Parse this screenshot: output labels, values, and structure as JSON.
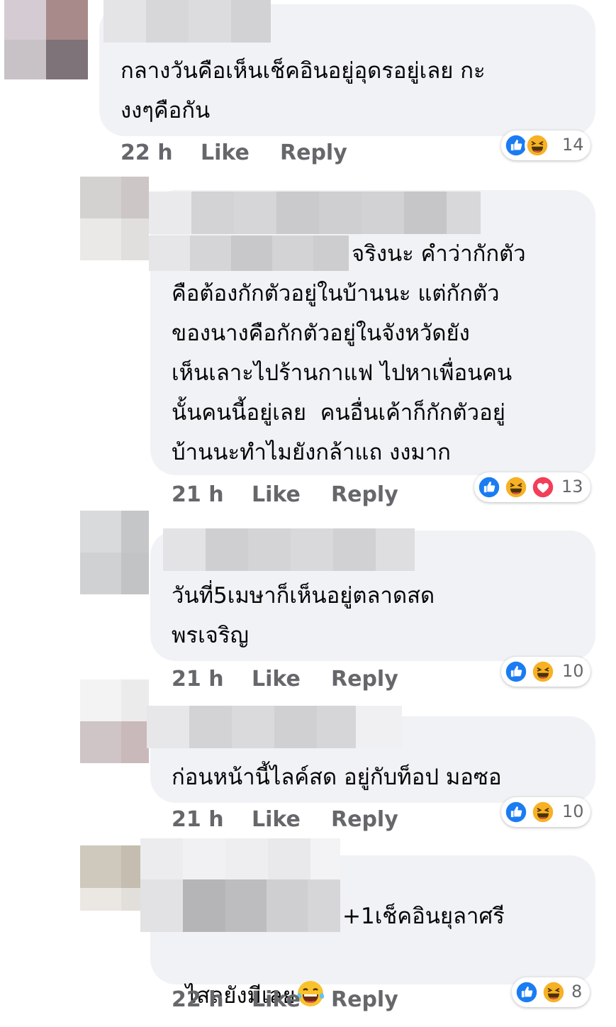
{
  "comments": [
    {
      "text": "กลางวันคือเห็นเช็คอินอยู่อุดรอยู่เลย กะ\nงงๆคือกัน",
      "time": "22 h",
      "like": "Like",
      "reply": "Reply",
      "reaction_count": "14",
      "reactions": [
        "like-icon",
        "haha-icon"
      ]
    },
    {
      "text_lead": "จริงนะ คำว่ากักตัว",
      "text": "คือต้องกักตัวอยู่ในบ้านนะ แต่กักตัว\nของนางคือกักตัวอยู่ในจังหวัดยัง\nเห็นเลาะไปร้านกาแฟ ไปหาเพื่อนคน\nนั้นคนนี้อยู่เลย  คนอื่นเค้าก็กักตัวอยู่\nบ้านนะทำไมยังกล้าแถ งงมาก",
      "time": "21 h",
      "like": "Like",
      "reply": "Reply",
      "reaction_count": "13",
      "reactions": [
        "like-icon",
        "haha-icon",
        "love-icon"
      ]
    },
    {
      "text": "วันที่5เมษาก็เห็นอยู่ตลาดสด\nพรเจริญ",
      "time": "21 h",
      "like": "Like",
      "reply": "Reply",
      "reaction_count": "10",
      "reactions": [
        "like-icon",
        "haha-icon"
      ]
    },
    {
      "text": "ก่อนหน้านี้ไลค์สด อยู่กับท็อป มอซอ",
      "time": "21 h",
      "like": "Like",
      "reply": "Reply",
      "reaction_count": "10",
      "reactions": [
        "like-icon",
        "haha-icon"
      ]
    },
    {
      "text_lead": "+1เช็คอินยุลาศรี",
      "text": "ไสลยังมีเลย",
      "time": "22 h",
      "like": "Like",
      "reply": "Reply",
      "reaction_count": "8",
      "reactions": [
        "like-icon",
        "haha-icon"
      ]
    }
  ],
  "colors": {
    "bubble": "#f0f2f5",
    "meta": "#65676b",
    "like_blue": "#1877f2",
    "haha_yellow": "#f7b125",
    "love_red": "#f33e58"
  }
}
